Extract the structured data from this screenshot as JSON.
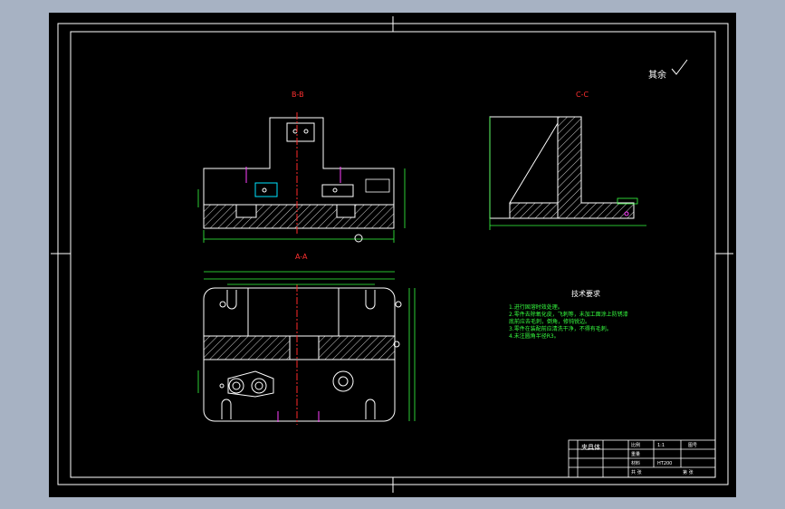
{
  "drawing": {
    "roughness_note": "其余",
    "views": {
      "section_bb": "B-B",
      "section_cc": "C-C",
      "section_aa": "A-A"
    },
    "technical_requirements": {
      "title": "技术要求",
      "items": [
        "1.进行固溶时效处理。",
        "2.零件去除氧化皮，飞刺等，未加工面涂上防锈漆",
        "  底前应去毛刺，倒角，修钝锐边。",
        "3.零件在装配前应清洗干净，不得有毛刺。",
        "4.未注圆角半径R3。"
      ]
    },
    "title_block": {
      "part_name": "夹具体",
      "cells": [
        "比例",
        "1:1",
        "图号",
        "重量",
        "材料",
        "HT200",
        "共 张",
        "第 张"
      ]
    },
    "colors": {
      "background": "#000000",
      "outline": "#ffffff",
      "dimension": "#36ff40",
      "centerline": "#ff2a2a",
      "hatch": "#ffffff",
      "cyan_detail": "#00e5ff",
      "magenta_detail": "#ff40ff"
    }
  }
}
